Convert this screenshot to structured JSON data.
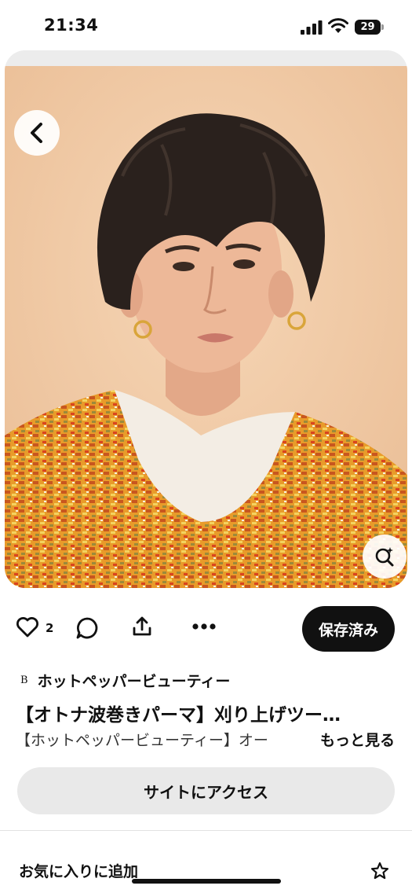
{
  "status": {
    "time": "21:34",
    "battery": "29"
  },
  "pin": {
    "like_count": "2",
    "saved_label": "保存済み",
    "source_logo": "B",
    "source_name": "ホットペッパービューティー",
    "title": "【オトナ波巻きパーマ】刈り上げツー…",
    "description": "【ホットペッパービューティー】オー",
    "see_more": "もっと見る",
    "visit_label": "サイトにアクセス",
    "favorite_label": "お気に入りに追加"
  },
  "icons": {
    "back": "chevron-left-icon",
    "lens": "visual-search-icon",
    "scissors": "scissors-icon",
    "like": "heart-icon",
    "comment": "comment-icon",
    "share": "share-icon",
    "more": "more-icon",
    "star": "star-icon"
  },
  "colors": {
    "accent": "#111111",
    "button_bg": "#e9e9e9",
    "photo_bg": "#f1cba8",
    "sweater": "#e89b2a"
  }
}
